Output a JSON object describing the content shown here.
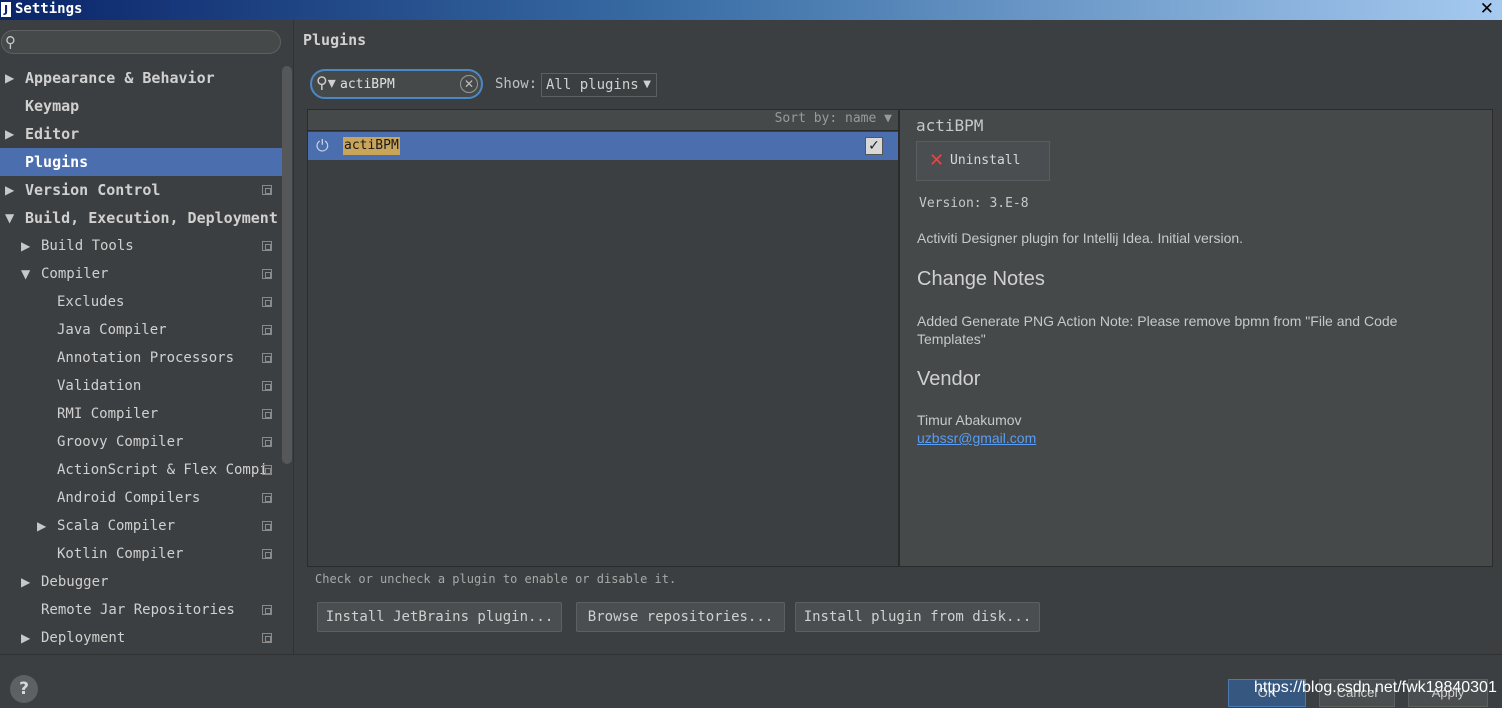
{
  "window": {
    "title": "Settings",
    "app_icon": "intellij-icon",
    "close_glyph": "✕"
  },
  "sidebar": {
    "search_value": "",
    "items": [
      {
        "label": "Appearance & Behavior",
        "level": 0,
        "arrow": "▶",
        "top": true,
        "project": false,
        "selected": false
      },
      {
        "label": "Keymap",
        "level": 0,
        "arrow": "",
        "top": true,
        "project": false,
        "selected": false
      },
      {
        "label": "Editor",
        "level": 0,
        "arrow": "▶",
        "top": true,
        "project": false,
        "selected": false
      },
      {
        "label": "Plugins",
        "level": 0,
        "arrow": "",
        "top": true,
        "project": false,
        "selected": true
      },
      {
        "label": "Version Control",
        "level": 0,
        "arrow": "▶",
        "top": true,
        "project": true,
        "selected": false
      },
      {
        "label": "Build, Execution, Deployment",
        "level": 0,
        "arrow": "▼",
        "top": true,
        "project": false,
        "selected": false
      },
      {
        "label": "Build Tools",
        "level": 1,
        "arrow": "▶",
        "top": false,
        "project": true,
        "selected": false
      },
      {
        "label": "Compiler",
        "level": 1,
        "arrow": "▼",
        "top": false,
        "project": true,
        "selected": false
      },
      {
        "label": "Excludes",
        "level": 2,
        "arrow": "",
        "top": false,
        "project": true,
        "selected": false
      },
      {
        "label": "Java Compiler",
        "level": 2,
        "arrow": "",
        "top": false,
        "project": true,
        "selected": false
      },
      {
        "label": "Annotation Processors",
        "level": 2,
        "arrow": "",
        "top": false,
        "project": true,
        "selected": false
      },
      {
        "label": "Validation",
        "level": 2,
        "arrow": "",
        "top": false,
        "project": true,
        "selected": false
      },
      {
        "label": "RMI Compiler",
        "level": 2,
        "arrow": "",
        "top": false,
        "project": true,
        "selected": false
      },
      {
        "label": "Groovy Compiler",
        "level": 2,
        "arrow": "",
        "top": false,
        "project": true,
        "selected": false
      },
      {
        "label": "ActionScript & Flex Compi",
        "level": 2,
        "arrow": "",
        "top": false,
        "project": true,
        "selected": false
      },
      {
        "label": "Android Compilers",
        "level": 2,
        "arrow": "",
        "top": false,
        "project": true,
        "selected": false
      },
      {
        "label": "Scala Compiler",
        "level": 2,
        "arrow": "▶",
        "top": false,
        "project": true,
        "selected": false
      },
      {
        "label": "Kotlin Compiler",
        "level": 2,
        "arrow": "",
        "top": false,
        "project": true,
        "selected": false
      },
      {
        "label": "Debugger",
        "level": 1,
        "arrow": "▶",
        "top": false,
        "project": false,
        "selected": false
      },
      {
        "label": "Remote Jar Repositories",
        "level": 1,
        "arrow": "",
        "top": false,
        "project": true,
        "selected": false
      },
      {
        "label": "Deployment",
        "level": 1,
        "arrow": "▶",
        "top": false,
        "project": true,
        "selected": false
      }
    ]
  },
  "main": {
    "title": "Plugins",
    "search_value": "actiBPM",
    "show_label": "Show:",
    "show_value": "All plugins",
    "sort_label": "Sort by: name ▼",
    "plugins": [
      {
        "name": "actiBPM",
        "enabled": true,
        "check_glyph": "✓"
      }
    ],
    "hint": "Check or uncheck a plugin to enable or disable it.",
    "buttons": {
      "install_jetbrains": "Install JetBrains plugin...",
      "browse": "Browse repositories...",
      "install_disk": "Install plugin from disk..."
    }
  },
  "detail": {
    "name": "actiBPM",
    "uninstall_label": "Uninstall",
    "version": "Version: 3.E-8",
    "description": "Activiti Designer plugin for Intellij Idea. Initial version.",
    "change_notes_heading": "Change Notes",
    "change_notes": "Added Generate PNG Action Note: Please remove bpmn from \"File and Code Templates\"",
    "vendor_heading": "Vendor",
    "vendor_name": "Timur Abakumov",
    "vendor_email": "uzbssr@gmail.com"
  },
  "footer": {
    "help": "?",
    "ok": "OK",
    "cancel": "Cancel",
    "apply": "Apply",
    "watermark": "https://blog.csdn.net/fwk19840301"
  },
  "colors": {
    "selection": "#4b6eaf",
    "background": "#3c3f41",
    "link": "#589df6",
    "focus": "#4a88c7",
    "uninstall": "#e04848"
  }
}
